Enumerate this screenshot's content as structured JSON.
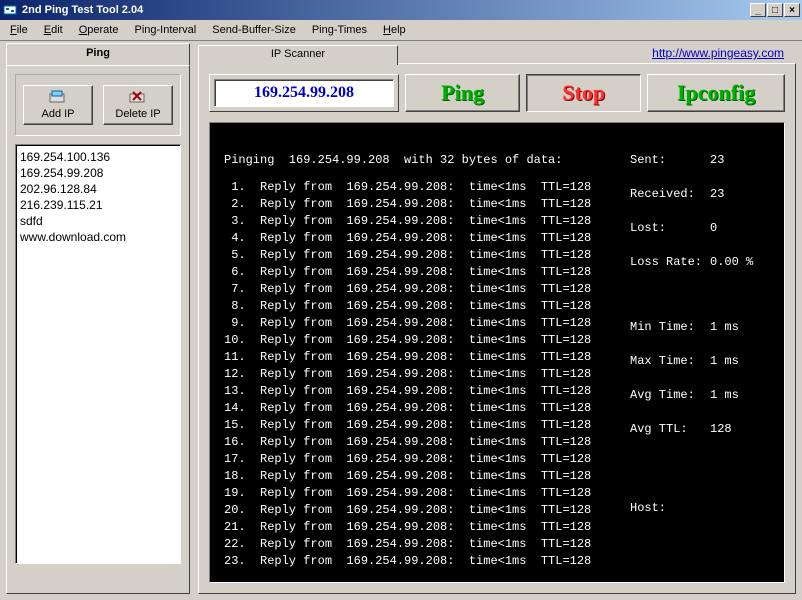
{
  "window": {
    "title": "2nd Ping Test Tool 2.04"
  },
  "menu": {
    "file": "File",
    "edit": "Edit",
    "operate": "Operate",
    "ping_interval": "Ping-Interval",
    "send_buffer_size": "Send-Buffer-Size",
    "ping_times": "Ping-Times",
    "help": "Help"
  },
  "tabs": {
    "ping": "Ping",
    "ip_scanner": "IP Scanner"
  },
  "url": "http://www.pingeasy.com",
  "sidebar": {
    "add_ip": "Add IP",
    "delete_ip": "Delete IP",
    "items": [
      "169.254.100.136",
      "169.254.99.208",
      "202.96.128.84",
      "216.239.115.21",
      "sdfd",
      "www.download.com"
    ]
  },
  "ip_input": "169.254.99.208",
  "buttons": {
    "ping": "Ping",
    "stop": "Stop",
    "ipconfig": "Ipconfig"
  },
  "console": {
    "header": "Pinging  169.254.99.208  with 32 bytes of data:",
    "lines": [
      " 1.  Reply from  169.254.99.208:  time<1ms  TTL=128",
      " 2.  Reply from  169.254.99.208:  time<1ms  TTL=128",
      " 3.  Reply from  169.254.99.208:  time<1ms  TTL=128",
      " 4.  Reply from  169.254.99.208:  time<1ms  TTL=128",
      " 5.  Reply from  169.254.99.208:  time<1ms  TTL=128",
      " 6.  Reply from  169.254.99.208:  time<1ms  TTL=128",
      " 7.  Reply from  169.254.99.208:  time<1ms  TTL=128",
      " 8.  Reply from  169.254.99.208:  time<1ms  TTL=128",
      " 9.  Reply from  169.254.99.208:  time<1ms  TTL=128",
      "10.  Reply from  169.254.99.208:  time<1ms  TTL=128",
      "11.  Reply from  169.254.99.208:  time<1ms  TTL=128",
      "12.  Reply from  169.254.99.208:  time<1ms  TTL=128",
      "13.  Reply from  169.254.99.208:  time<1ms  TTL=128",
      "14.  Reply from  169.254.99.208:  time<1ms  TTL=128",
      "15.  Reply from  169.254.99.208:  time<1ms  TTL=128",
      "16.  Reply from  169.254.99.208:  time<1ms  TTL=128",
      "17.  Reply from  169.254.99.208:  time<1ms  TTL=128",
      "18.  Reply from  169.254.99.208:  time<1ms  TTL=128",
      "19.  Reply from  169.254.99.208:  time<1ms  TTL=128",
      "20.  Reply from  169.254.99.208:  time<1ms  TTL=128",
      "21.  Reply from  169.254.99.208:  time<1ms  TTL=128",
      "22.  Reply from  169.254.99.208:  time<1ms  TTL=128",
      "23.  Reply from  169.254.99.208:  time<1ms  TTL=128"
    ]
  },
  "stats": {
    "sent_k": "Sent:",
    "sent_v": "23",
    "recv_k": "Received:",
    "recv_v": "23",
    "lost_k": "Lost:",
    "lost_v": "0",
    "rate_k": "Loss Rate:",
    "rate_v": "0.00 %",
    "min_k": "Min Time:",
    "min_v": "1 ms",
    "max_k": "Max Time:",
    "max_v": "1 ms",
    "avg_k": "Avg Time:",
    "avg_v": "1 ms",
    "ttl_k": "Avg TTL:",
    "ttl_v": "128",
    "host_k": "Host:",
    "host_v": ""
  }
}
